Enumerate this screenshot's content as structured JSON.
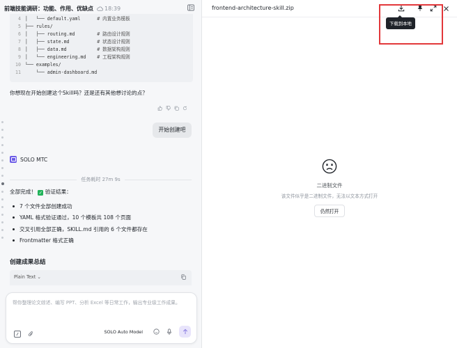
{
  "header": {
    "title": "前端技能调研：功能、作用、优缺点",
    "time": "18:39"
  },
  "code_block": {
    "lines": [
      {
        "num": "4",
        "text": "│   └── default.yaml      ",
        "comment": "# 内置业务模板"
      },
      {
        "num": "5",
        "text": "├── rules/",
        "comment": ""
      },
      {
        "num": "6",
        "text": "│   ├── routing.md        ",
        "comment": "# 路由设计规则"
      },
      {
        "num": "7",
        "text": "│   ├── state.md          ",
        "comment": "# 状态设计规则"
      },
      {
        "num": "8",
        "text": "│   ├── data.md           ",
        "comment": "# 数据架构规则"
      },
      {
        "num": "9",
        "text": "│   └── engineering.md    ",
        "comment": "# 工程架构规则"
      },
      {
        "num": "10",
        "text": "└── examples/",
        "comment": ""
      },
      {
        "num": "11",
        "text": "    └── admin-dashboard.md",
        "comment": ""
      }
    ]
  },
  "question": "你想现在开始创建这个Skill吗？还是还有其他想讨论的点？",
  "start_button": "开始创建吧",
  "agent": {
    "name": "SOLO MTC"
  },
  "task_duration": "任务耗时 27m 9s",
  "result": {
    "heading": "全部完成！",
    "check_label": "验证结果：",
    "items": [
      "7 个文件全部创建成功",
      "YAML 格式验证通过，10 个模板共 108 个页面",
      "交叉引用全部正确，SKILL.md 引用的 6 个文件都存在",
      "Frontmatter 格式正确"
    ]
  },
  "summary_title": "创建成果总结",
  "code_lang": "Plain Text",
  "composer": {
    "placeholder": "帮你整理论文综述、编写 PPT、分析 Excel 等日常工作，输出专业级工作成果。",
    "model": "SOLO Auto Model"
  },
  "viewer": {
    "filename": "frontend-architecture-skill.zip",
    "tooltip": "下载到本地",
    "binary_title": "二进制文件",
    "binary_desc": "该文件似乎是二进制文件，无法以文本方式打开",
    "open_anyway": "仍然打开"
  },
  "colors": {
    "accent": "#6c5ce7",
    "check": "#21b35a",
    "highlight": "#e2373a"
  }
}
